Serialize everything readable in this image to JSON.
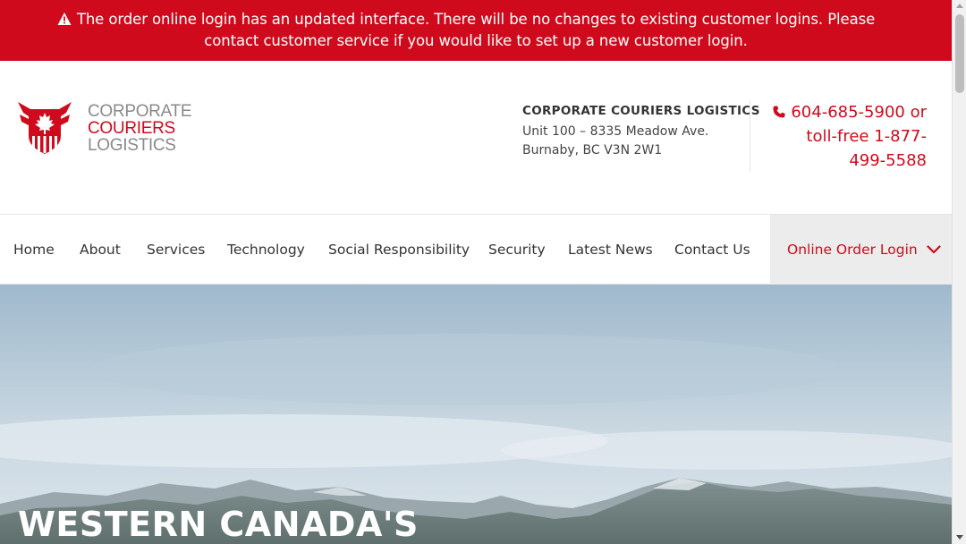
{
  "alert": {
    "icon": "warning-icon",
    "text": "The order online login has an updated interface. There will be no changes to existing customer logins. Please contact customer service if you would like to set up a new customer login.",
    "background_color": "#cf0a1c"
  },
  "logo": {
    "icon": "maple-leaf-shield-logo",
    "line1": "CORPORATE",
    "line2": "COURIERS",
    "line3": "LOGISTICS"
  },
  "address": {
    "company": "CORPORATE COURIERS LOGISTICS",
    "line1": "Unit 100 – 8335 Meadow Ave.",
    "line2": "Burnaby, BC V3N 2W1"
  },
  "phone": {
    "icon": "phone-icon",
    "line1": "604-685-5900 or",
    "line2": "toll-free 1-877-",
    "line3": "499-5588"
  },
  "nav": {
    "items": [
      {
        "label": "Home"
      },
      {
        "label": "About"
      },
      {
        "label": "Services"
      },
      {
        "label": "Technology"
      },
      {
        "label": "Social Responsibility"
      },
      {
        "label": "Security"
      },
      {
        "label": "Latest News"
      },
      {
        "label": "Contact Us"
      }
    ],
    "login_label": "Online Order Login",
    "login_icon": "chevron-down-icon"
  },
  "hero": {
    "title": "WESTERN CANADA'S"
  },
  "colors": {
    "brand_red": "#cf0a1c",
    "logo_gray": "#8a8a8a",
    "nav_login_bg": "#ececec"
  }
}
